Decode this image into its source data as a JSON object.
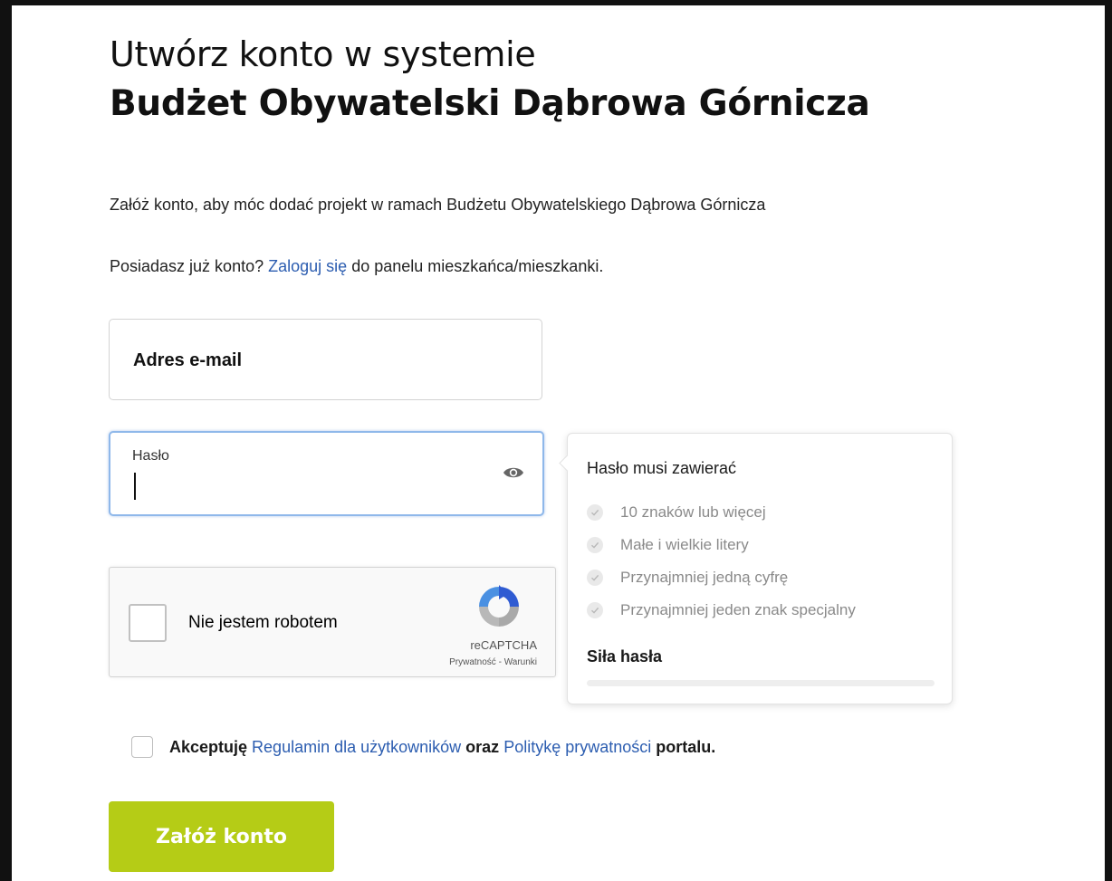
{
  "header": {
    "title_line1": "Utwórz konto w systemie",
    "title_line2": "Budżet Obywatelski Dąbrowa Górnicza"
  },
  "intro": "Załóż konto, aby móc dodać projekt w ramach Budżetu Obywatelskiego Dąbrowa Górnicza",
  "login_prompt": {
    "before": "Posiadasz już konto?",
    "link": "Zaloguj się",
    "after": "do panelu mieszkańca/mieszkanki."
  },
  "form": {
    "email_label": "Adres e-mail",
    "password_label": "Hasło",
    "submit_label": "Załóż konto"
  },
  "password_tip": {
    "title": "Hasło musi zawierać",
    "requirements": [
      "10 znaków lub więcej",
      "Małe i wielkie litery",
      "Przynajmniej jedną cyfrę",
      "Przynajmniej jeden znak specjalny"
    ],
    "strength_label": "Siła hasła",
    "strength": 0
  },
  "captcha": {
    "label": "Nie jestem robotem",
    "brand": "reCAPTCHA",
    "links": "Prywatność - Warunki"
  },
  "terms": {
    "before": "Akceptuję",
    "link1": "Regulamin dla użytkowników",
    "middle": "oraz",
    "link2": "Politykę prywatności",
    "after": "portalu."
  },
  "colors": {
    "accent": "#b5cc16",
    "link": "#2c5db0",
    "focus_border": "#8fb8ea"
  }
}
